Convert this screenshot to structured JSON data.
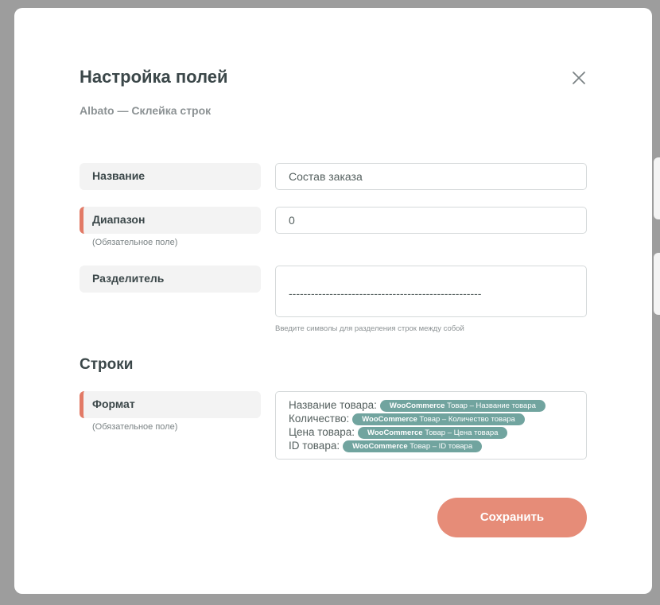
{
  "modal": {
    "title": "Настройка полей",
    "subtitle": "Albato — Склейка строк"
  },
  "fields": {
    "name": {
      "label": "Название",
      "value": "Состав заказа"
    },
    "range": {
      "label": "Диапазон",
      "value": "0",
      "required_hint": "(Обязательное поле)"
    },
    "separator": {
      "label": "Разделитель",
      "value": "----------------------------------------------------",
      "help": "Введите символы для разделения строк между собой"
    }
  },
  "rows_section": {
    "title": "Строки",
    "format": {
      "label": "Формат",
      "required_hint": "(Обязательное поле)",
      "lines": [
        {
          "prefix": "Название товара:",
          "tag_source": "WooCommerce",
          "tag_text": "Товар – Название товара"
        },
        {
          "prefix": "Количество:",
          "tag_source": "WooCommerce",
          "tag_text": "Товар – Количество товара"
        },
        {
          "prefix": "Цена товара:",
          "tag_source": "WooCommerce",
          "tag_text": "Товар – Цена товара"
        },
        {
          "prefix": "ID товара:",
          "tag_source": "WooCommerce",
          "tag_text": "Товар – ID товара"
        }
      ]
    }
  },
  "actions": {
    "save_label": "Сохранить"
  },
  "icons": {
    "close": "close-icon"
  },
  "colors": {
    "accent": "#e68c78",
    "required_marker": "#e27a66",
    "tag_bg": "#71a49f"
  }
}
